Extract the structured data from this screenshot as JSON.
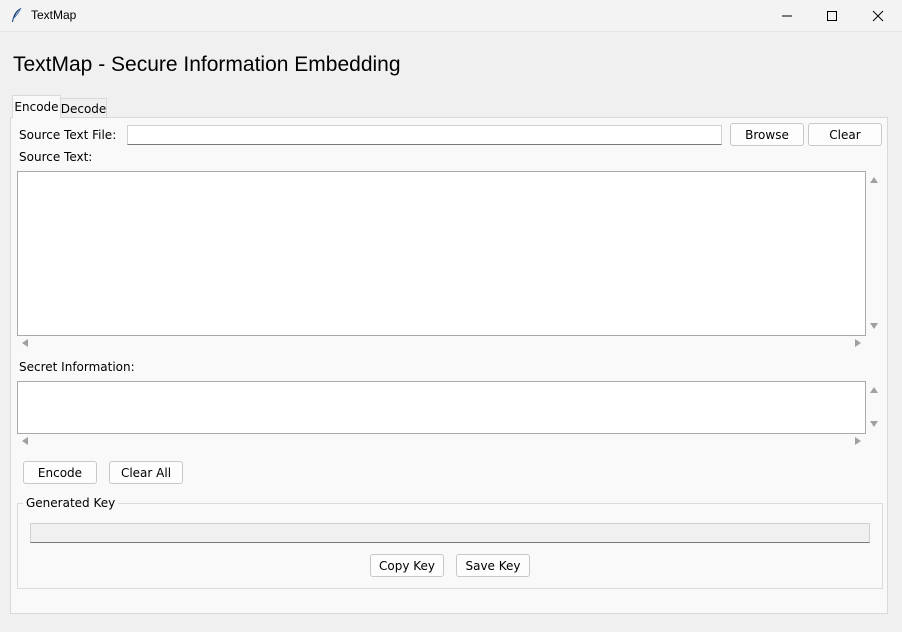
{
  "window": {
    "title": "TextMap",
    "minimize_icon": "minimize-icon",
    "maximize_icon": "maximize-icon",
    "close_icon": "close-icon"
  },
  "heading": "TextMap - Secure Information Embedding",
  "tabs": [
    {
      "label": "Encode",
      "active": true
    },
    {
      "label": "Decode",
      "active": false
    }
  ],
  "encode": {
    "source_file_label": "Source Text File:",
    "source_file_value": "",
    "browse_label": "Browse",
    "clear_label": "Clear",
    "source_text_label": "Source Text:",
    "source_text_value": "",
    "secret_label": "Secret Information:",
    "secret_value": "",
    "encode_label": "Encode",
    "clear_all_label": "Clear All",
    "generated_key_label": "Generated Key",
    "generated_key_value": "",
    "copy_key_label": "Copy Key",
    "save_key_label": "Save Key"
  },
  "colors": {
    "window_bg": "#f0f0f0",
    "panel_bg": "#f9f9f9",
    "field_bg": "#ffffff",
    "border": "#d9d9d9",
    "scroll_arrow": "#a0a0a0"
  }
}
